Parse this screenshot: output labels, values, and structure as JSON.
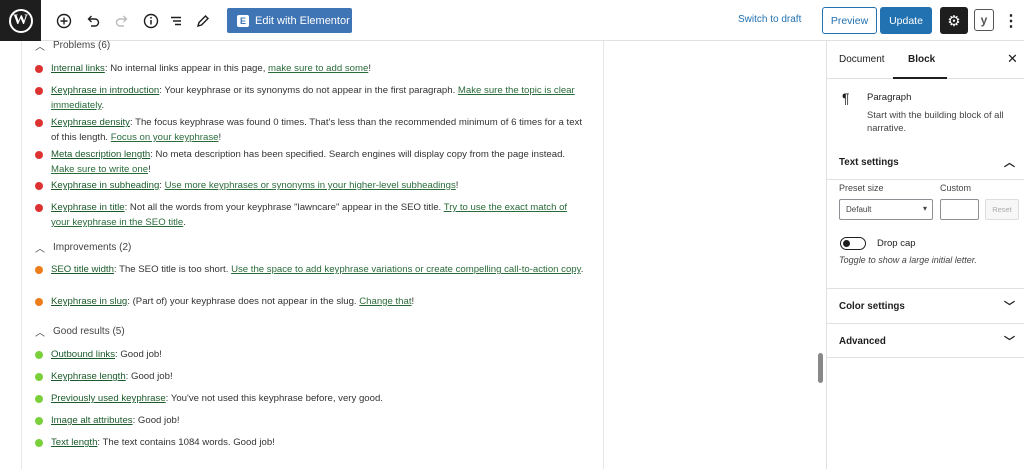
{
  "toolbar": {
    "elementor_label": "Edit with Elementor",
    "switch_draft_label": "Switch to draft",
    "preview_label": "Preview",
    "update_label": "Update"
  },
  "sections": {
    "problems": "Problems (6)",
    "improvements": "Improvements (2)",
    "good": "Good results (5)"
  },
  "problems": [
    {
      "link": "Internal links",
      "text": ": No internal links appear in this page, ",
      "action": "make sure to add some",
      "tail": "!"
    },
    {
      "link": "Keyphrase in introduction",
      "text": ": Your keyphrase or its synonyms do not appear in the first paragraph. ",
      "action": "Make sure the topic is clear immediately",
      "tail": "."
    },
    {
      "link": "Keyphrase density",
      "text": ": The focus keyphrase was found 0 times. That's less than the recommended minimum of 6 times for a text of this length. ",
      "action": "Focus on your keyphrase",
      "tail": "!"
    },
    {
      "link": "Meta description length",
      "text": ": No meta description has been specified. Search engines will display copy from the page instead. ",
      "action": "Make sure to write one",
      "tail": "!"
    },
    {
      "link": "Keyphrase in subheading",
      "text": ": ",
      "action": "Use more keyphrases or synonyms in your higher-level subheadings",
      "tail": "!"
    },
    {
      "link": "Keyphrase in title",
      "text": ": Not all the words from your keyphrase \"lawncare\" appear in the SEO title. ",
      "action": "Try to use the exact match of your keyphrase in the SEO title",
      "tail": "."
    }
  ],
  "improvements": [
    {
      "link": "SEO title width",
      "text": ": The SEO title is too short. ",
      "action": "Use the space to add keyphrase variations or create compelling call-to-action copy",
      "tail": "."
    },
    {
      "link": "Keyphrase in slug",
      "text": ": (Part of) your keyphrase does not appear in the slug. ",
      "action": "Change that",
      "tail": "!"
    }
  ],
  "good": [
    {
      "link": "Outbound links",
      "text": ": Good job!"
    },
    {
      "link": "Keyphrase length",
      "text": ": Good job!"
    },
    {
      "link": "Previously used keyphrase",
      "text": ": You've not used this keyphrase before, very good."
    },
    {
      "link": "Image alt attributes",
      "text": ": Good job!"
    },
    {
      "link": "Text length",
      "text": ": The text contains 1084 words. Good job!"
    }
  ],
  "sidebar": {
    "tab_document": "Document",
    "tab_block": "Block",
    "block_name": "Paragraph",
    "block_desc": "Start with the building block of all narrative.",
    "text_settings": "Text settings",
    "preset_size_label": "Preset size",
    "custom_label": "Custom",
    "preset_value": "Default",
    "reset_label": "Reset",
    "drop_cap_label": "Drop cap",
    "drop_cap_help": "Toggle to show a large initial letter.",
    "color_settings": "Color settings",
    "advanced": "Advanced"
  },
  "colors": {
    "problem": "#dc3232",
    "improvement": "#ee7c1b",
    "good": "#7ad03a",
    "accent": "#2271b1"
  }
}
